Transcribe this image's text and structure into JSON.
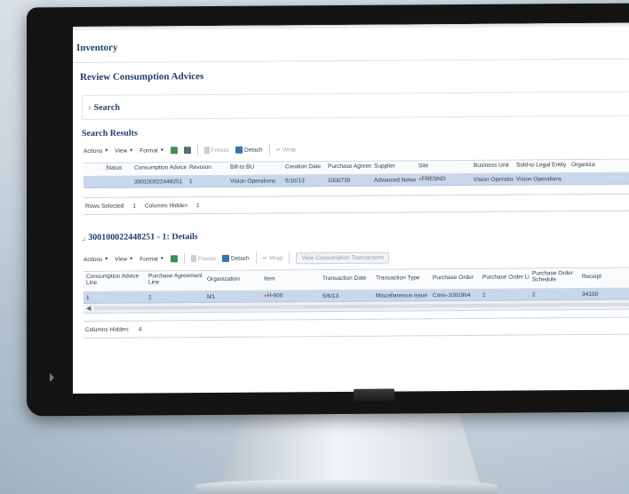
{
  "module_title": "Inventory",
  "page_title": "Review Consumption Advices",
  "search_label": "Search",
  "results_title": "Search Results",
  "toolbar1": {
    "actions": "Actions",
    "view": "View",
    "format": "Format",
    "freeze": "Freeze",
    "detach": "Detach",
    "wrap": "Wrap"
  },
  "table1": {
    "headers": [
      "Status",
      "Consumption Advice",
      "Revision",
      "Bill-to BU",
      "Creation Date",
      "Purchase Agreement",
      "Supplier",
      "Site",
      "Business Unit",
      "Sold-to Legal Entity",
      "Organizati"
    ],
    "row": [
      "",
      "300100022448251",
      "1",
      "Vision Operations",
      "5/16/13",
      "1000739",
      "Advanced Network D",
      "FRESNO",
      "Vision Operations",
      "Vision Operations",
      ""
    ]
  },
  "footer1": {
    "rows_selected_label": "Rows Selected",
    "rows_selected_value": "1",
    "columns_hidden_label": "Columns Hidden",
    "columns_hidden_value": "1"
  },
  "details_title": "300100022448251 - 1: Details",
  "toolbar2": {
    "actions": "Actions",
    "view": "View",
    "format": "Format",
    "freeze": "Freeze",
    "detach": "Detach",
    "wrap": "Wrap",
    "view_transactions": "View Consumption Transactions"
  },
  "table2": {
    "headers": [
      "Consumption Advice Line",
      "Purchase Agreement Line",
      "Organization",
      "Item",
      "Transaction Date",
      "Transaction Type",
      "Purchase Order",
      "Purchase Order Line",
      "Purchase Order Schedule",
      "Receipt"
    ],
    "row": [
      "1",
      "1",
      "M1",
      "H-600",
      "5/6/13",
      "Miscellaneous issue",
      "Cons-1001964",
      "1",
      "2",
      "34100"
    ]
  },
  "footer2": {
    "columns_hidden_label": "Columns Hidden:",
    "columns_hidden_value": "4"
  },
  "colors": {
    "title": "#1e3f6b",
    "selected_row": "#c8d7ea",
    "bezel": "#141414"
  }
}
